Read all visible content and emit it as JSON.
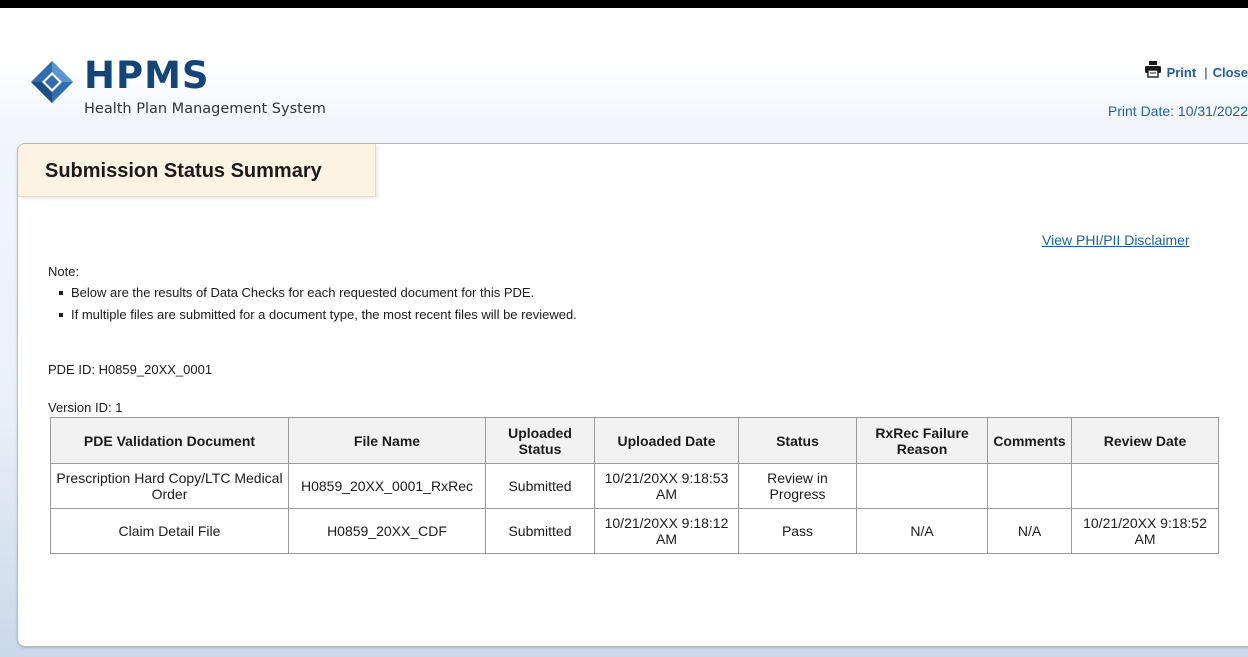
{
  "header": {
    "logo_title": "HPMS",
    "logo_subtitle": "Health Plan Management System",
    "print_label": "Print",
    "close_label": "Close",
    "print_date": "Print Date: 10/31/2022"
  },
  "panel": {
    "title": "Submission Status Summary",
    "disclaimer_link": "View PHI/PII Disclaimer",
    "note_label": "Note:",
    "notes": [
      "Below are the results of Data Checks for each requested document for this PDE.",
      "If multiple files are submitted for a document type, the most recent files will be reviewed."
    ],
    "pde_id": "PDE ID: H0859_20XX_0001",
    "version_id": "Version ID: 1"
  },
  "table": {
    "headers": [
      "PDE Validation Document",
      "File Name",
      "Uploaded Status",
      "Uploaded Date",
      "Status",
      "RxRec Failure Reason",
      "Comments",
      "Review Date"
    ],
    "rows": [
      [
        "Prescription Hard Copy/LTC Medical Order",
        "H0859_20XX_0001_RxRec",
        "Submitted",
        "10/21/20XX 9:18:53 AM",
        "Review in Progress",
        "",
        "",
        ""
      ],
      [
        "Claim Detail File",
        "H0859_20XX_CDF",
        "Submitted",
        "10/21/20XX 9:18:12 AM",
        "Pass",
        "N/A",
        "N/A",
        "10/21/20XX 9:18:52 AM"
      ]
    ]
  },
  "colors": {
    "brand": "#13457a",
    "link": "#1f5f9e",
    "tab_bg": "#fdf3e3"
  },
  "icons": [
    "hpms-logo-icon",
    "printer-icon"
  ]
}
